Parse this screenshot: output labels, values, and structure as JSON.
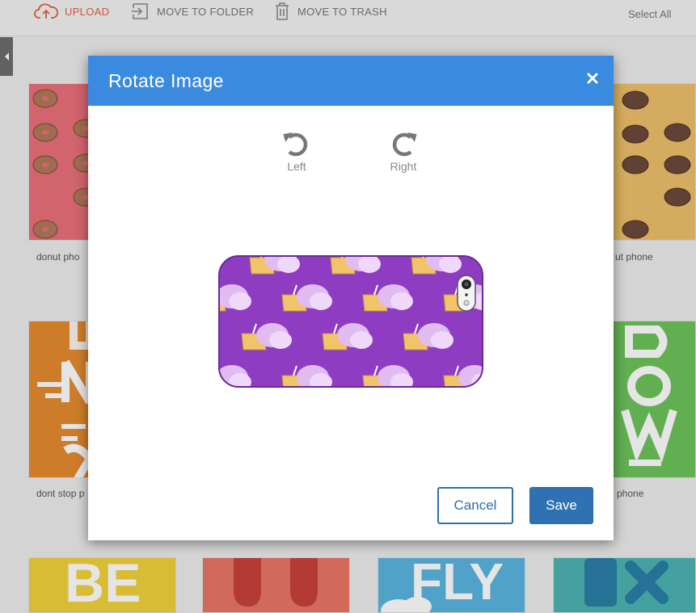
{
  "toolbar": {
    "upload_label": "UPLOAD",
    "move_label": "MOVE TO FOLDER",
    "trash_label": "MOVE TO TRASH",
    "select_all_label": "Select All",
    "upload_icon": "cloud-upload-icon",
    "move_icon": "move-to-folder-icon",
    "trash_icon": "trash-icon",
    "accent_color": "#e8603c"
  },
  "gallery": {
    "labels": {
      "donut_left": "donut pho",
      "donut_right": "ut phone",
      "dont_stop": "dont stop p",
      "green_right": "phone"
    },
    "card_texts": {
      "be": "BE",
      "fly": "FLY"
    }
  },
  "modal": {
    "title": "Rotate Image",
    "close_icon": "close-icon",
    "rotate_left_label": "Left",
    "rotate_right_label": "Right",
    "rotate_left_icon": "rotate-left-icon",
    "rotate_right_icon": "rotate-right-icon",
    "cancel_label": "Cancel",
    "save_label": "Save",
    "header_color": "#3a8be0",
    "save_color": "#2e72b4"
  }
}
